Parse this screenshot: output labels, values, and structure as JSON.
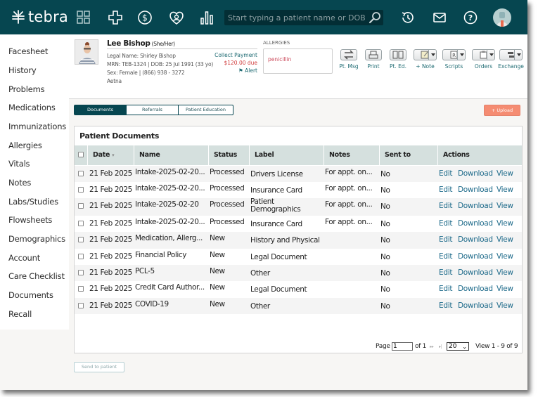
{
  "app": {
    "brand": "tebra"
  },
  "topbar": {
    "nav_icons": [
      "dashboard-grid-icon",
      "clinical-cross-icon",
      "billing-dollar-icon",
      "patient-engagement-heart-icon",
      "reports-bar-chart-icon"
    ],
    "search_placeholder": "Start typing a patient name or DOB",
    "right_icons": [
      "history-icon",
      "mail-icon",
      "help-icon"
    ]
  },
  "sidebar": {
    "items": [
      {
        "label": "Facesheet"
      },
      {
        "label": "History"
      },
      {
        "label": "Problems"
      },
      {
        "label": "Medications"
      },
      {
        "label": "Immunizations"
      },
      {
        "label": "Allergies"
      },
      {
        "label": "Vitals"
      },
      {
        "label": "Notes"
      },
      {
        "label": "Labs/Studies"
      },
      {
        "label": "Flowsheets"
      },
      {
        "label": "Demographics"
      },
      {
        "label": "Account"
      },
      {
        "label": "Care Checklist"
      },
      {
        "label": "Documents"
      },
      {
        "label": "Recall"
      }
    ]
  },
  "patient": {
    "name": "Lee Bishop",
    "pronouns": "(She/Her)",
    "legal_name": "Legal Name: Shirley Bishop",
    "mrn_dob": "MRN: TEB-1324 | DOB: 25 Jul 1991 (33 yo)",
    "sex_phone": "Sex: Female | (866) 938 - 3272",
    "insurance": "Aetna",
    "collect_payment": "Collect Payment",
    "amount_due": "$120.00 due",
    "alert": "Alert",
    "allergies_label": "ALLERGIES",
    "allergies": [
      "penicillin"
    ]
  },
  "toolbar": {
    "buttons": [
      {
        "label": "Pt. Msg",
        "icon": "exchange-arrows-icon"
      },
      {
        "label": "Print",
        "icon": "printer-icon"
      },
      {
        "label": "Pt. Ed.",
        "icon": "book-icon"
      },
      {
        "label": "+ Note",
        "icon": "note-pencil-icon"
      },
      {
        "label": "Scripts",
        "icon": "rx-icon"
      },
      {
        "label": "Orders",
        "icon": "clipboard-icon"
      },
      {
        "label": "Exchange",
        "icon": "exchange-icon"
      }
    ]
  },
  "tabs": [
    {
      "label": "Documents",
      "active": true
    },
    {
      "label": "Referrals",
      "active": false
    },
    {
      "label": "Patient Education",
      "active": false
    }
  ],
  "upload_label": "+ Upload",
  "documents": {
    "title": "Patient Documents",
    "columns": [
      "Date",
      "Name",
      "Status",
      "Label",
      "Notes",
      "Sent to patient",
      "Actions"
    ],
    "sort_indicator": "▾",
    "rows": [
      {
        "date": "21 Feb 2025",
        "name": "Intake-2025-02-20...",
        "status": "Processed",
        "label": "Drivers License",
        "notes": "For appt. on...",
        "sent": "No"
      },
      {
        "date": "21 Feb 2025",
        "name": "Intake-2025-02-20...",
        "status": "Processed",
        "label": "Insurance Card",
        "notes": "For appt. on...",
        "sent": "No"
      },
      {
        "date": "21 Feb 2025",
        "name": "Intake-2025-02-20",
        "status": "Processed",
        "label": "Patient Demographics",
        "notes": "For appt. on...",
        "sent": "No"
      },
      {
        "date": "21 Feb 2025",
        "name": "Intake-2025-02-20...",
        "status": "Processed",
        "label": "Insurance Card",
        "notes": "For appt. on...",
        "sent": "No"
      },
      {
        "date": "21 Feb 2025",
        "name": "Medication, Allerg...",
        "status": "New",
        "label": "History and Physical",
        "notes": "",
        "sent": "No"
      },
      {
        "date": "21 Feb 2025",
        "name": "Financial Policy",
        "status": "New",
        "label": "Legal Document",
        "notes": "",
        "sent": "No"
      },
      {
        "date": "21 Feb 2025",
        "name": "PCL-5",
        "status": "New",
        "label": "Other",
        "notes": "",
        "sent": "No"
      },
      {
        "date": "21 Feb 2025",
        "name": "Credit Card Author...",
        "status": "New",
        "label": "Legal Document",
        "notes": "",
        "sent": "No"
      },
      {
        "date": "21 Feb 2025",
        "name": "COVID-19",
        "status": "New",
        "label": "Other",
        "notes": "",
        "sent": "No"
      }
    ],
    "actions": [
      "Edit",
      "Download",
      "View"
    ]
  },
  "pager": {
    "page_label": "Page",
    "page_value": "1",
    "of_label": "of 1",
    "next_icon": "▸▸",
    "last_icon": "▸|",
    "page_size": "20",
    "view_text": "View 1 - 9 of 9"
  },
  "send_to_patient_label": "Send to patient",
  "colors": {
    "brand_dark_teal": "#064650",
    "upload_coral": "#f58c72",
    "link_blue": "#1d6a8a",
    "due_red": "#d03a3a",
    "allergy_pink": "#cc4b5c",
    "table_header": "#d5e0de"
  }
}
